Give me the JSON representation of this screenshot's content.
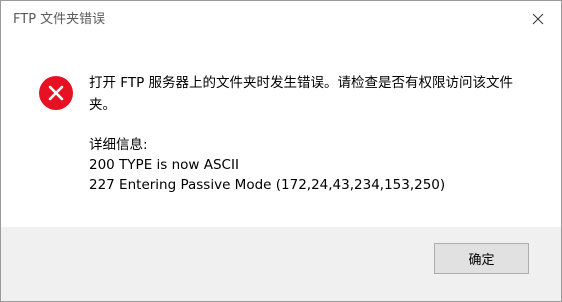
{
  "window": {
    "title": "FTP 文件夹错误",
    "close_icon": "close-icon"
  },
  "message": {
    "icon": "error-icon",
    "icon_color": "#e81123",
    "text": "打开 FTP 服务器上的文件夹时发生错误。请检查是否有权限访问该文件夹。"
  },
  "details": {
    "label": "详细信息:",
    "lines": [
      "200 TYPE is now ASCII",
      "227 Entering Passive Mode (172,24,43,234,153,250)"
    ]
  },
  "buttons": {
    "ok_label": "确定"
  }
}
